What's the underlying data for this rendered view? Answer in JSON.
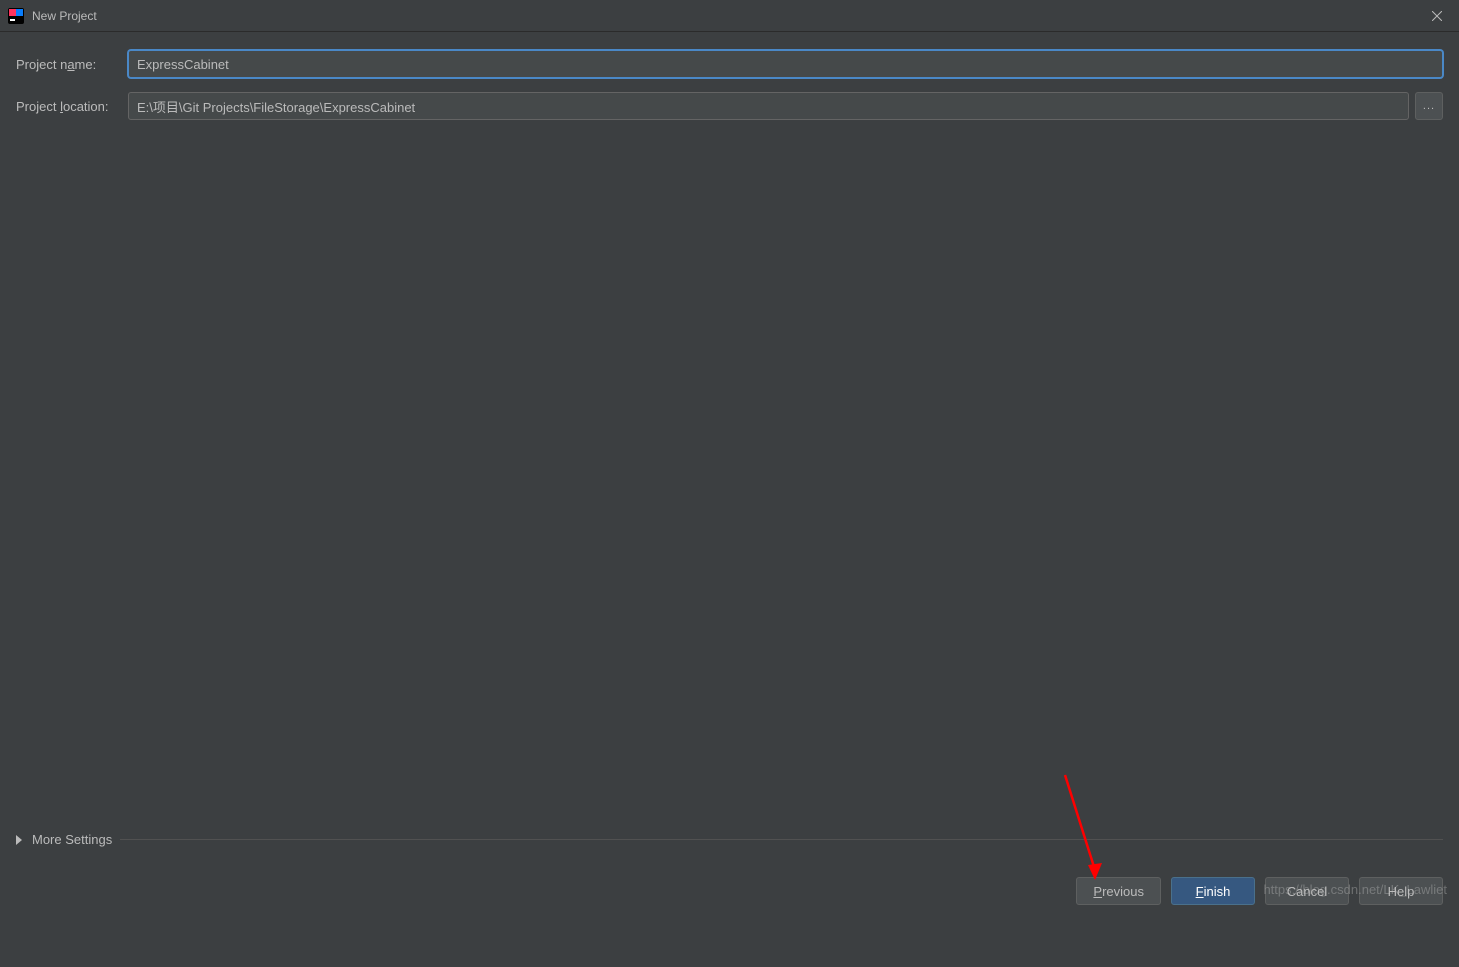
{
  "window": {
    "title": "New Project"
  },
  "form": {
    "project_name_label_pre": "Project n",
    "project_name_label_mn": "a",
    "project_name_label_post": "me:",
    "project_name_value": "ExpressCabinet",
    "project_location_label_pre": "Project ",
    "project_location_label_mn": "l",
    "project_location_label_post": "ocation:",
    "project_location_value": "E:\\项目\\Git Projects\\FileStorage\\ExpressCabinet",
    "browse_label": "..."
  },
  "more_settings": {
    "label_pre": "Mor",
    "label_mn": "e",
    "label_post": " Settings"
  },
  "buttons": {
    "previous_mn": "P",
    "previous_post": "revious",
    "finish_mn": "F",
    "finish_post": "inish",
    "cancel": "Cancel",
    "help": "Help"
  },
  "watermark": "https://blog.csdn.net/LK_Lawliet"
}
